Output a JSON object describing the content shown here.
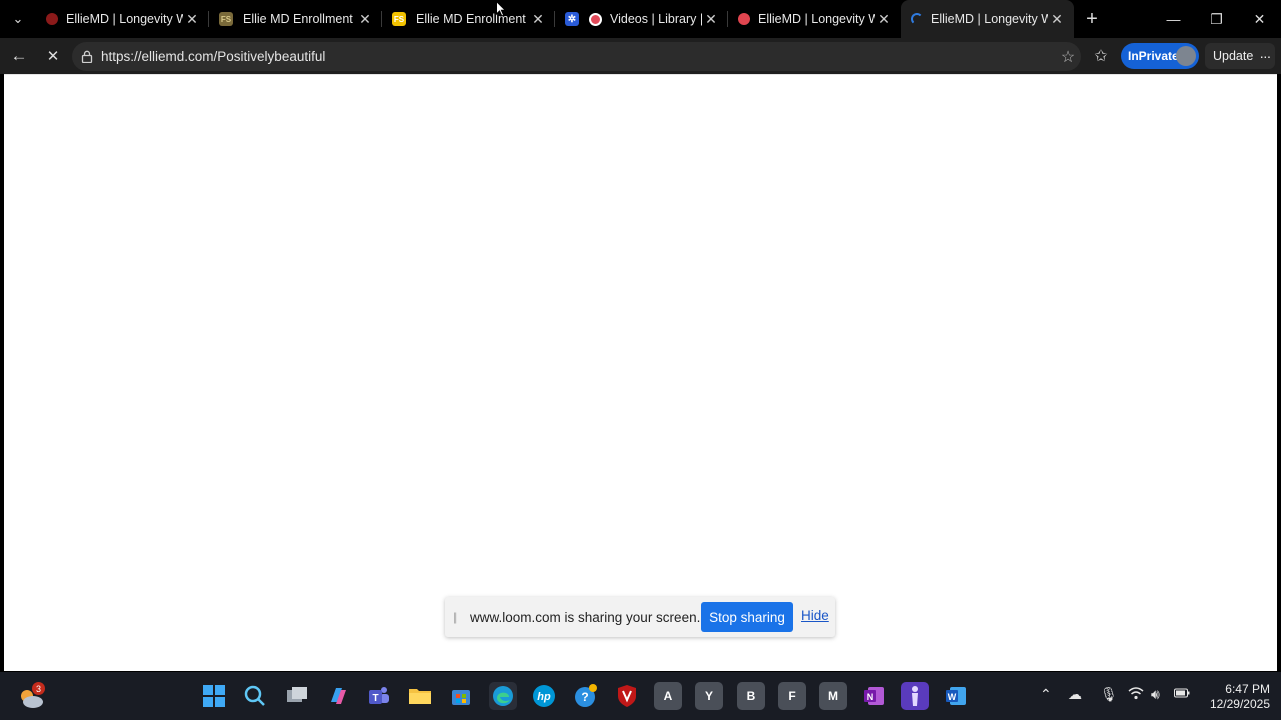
{
  "tabs": [
    {
      "title": "ElliеMD | Longevity With",
      "favicon": "red-circle-icon",
      "active": false
    },
    {
      "title": "Ellie MD Enrollment",
      "favicon": "fs-icon",
      "active": false
    },
    {
      "title": "Ellie MD Enrollment",
      "favicon": "fs-icon",
      "active": false
    },
    {
      "title": "Videos | Library | Lo",
      "favicon": "loom-icon",
      "active": false
    },
    {
      "title": "ElliеMD | Longevity With",
      "favicon": "red-circle-icon",
      "active": false
    },
    {
      "title": "ElliеMD | Longevity With",
      "favicon": "loading-icon",
      "active": true
    }
  ],
  "favicon_labels": {
    "fs": "FS"
  },
  "address_bar": {
    "url": "https://elliemd.com/Positivelybeautiful"
  },
  "toolbar": {
    "inprivate_label": "InPrivate",
    "update_label": "Update"
  },
  "share_bar": {
    "message": "www.loom.com is sharing your screen.",
    "stop_label": "Stop sharing",
    "hide_label": "Hide"
  },
  "taskbar": {
    "weather_badge": "3",
    "app_letters": [
      "A",
      "Y",
      "B",
      "F",
      "M"
    ],
    "time": "6:47 PM",
    "date": "12/29/2025"
  },
  "colors": {
    "accent": "#1a73e8",
    "inprivate": "#1562d6",
    "taskbar": "#191c24"
  }
}
